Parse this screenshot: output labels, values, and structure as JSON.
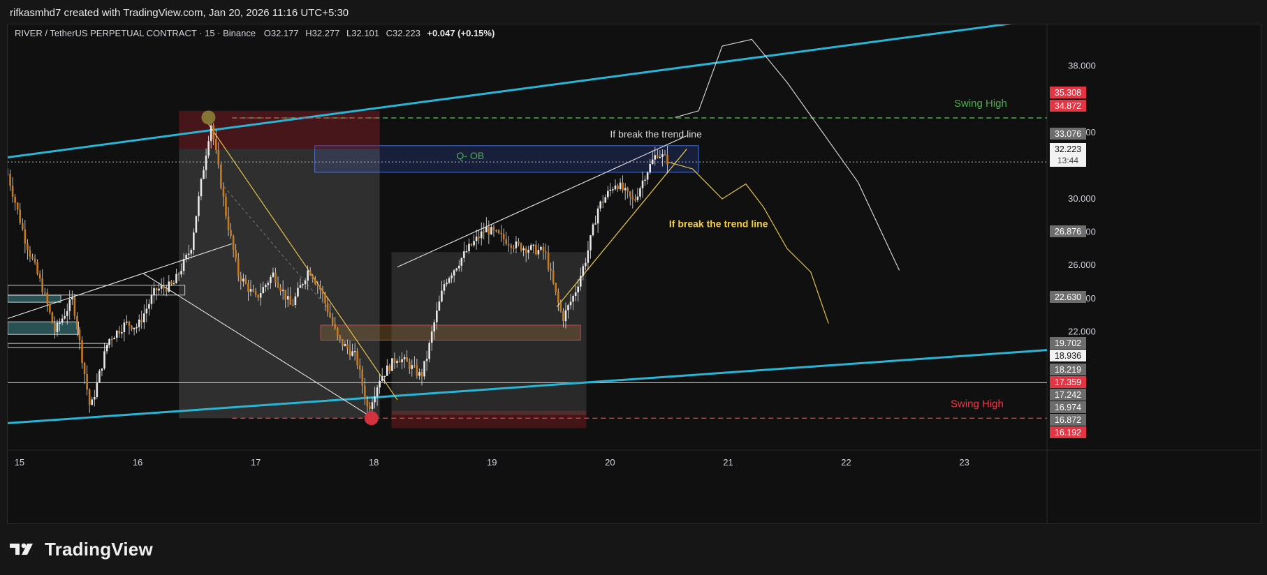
{
  "header": {
    "credit": "rifkasmhd7 created with TradingView.com, Jan 20, 2026 11:16 UTC+5:30"
  },
  "legend": {
    "symbol": "RIVER / TetherUS PERPETUAL CONTRACT · 15 · Binance",
    "o_label": "O",
    "o": "32.177",
    "h_label": "H",
    "h": "32.277",
    "l_label": "L",
    "l": "32.101",
    "c_label": "C",
    "c": "32.223",
    "change": "+0.047 (+0.15%)"
  },
  "footer": {
    "brand": "TradingView"
  },
  "colors": {
    "background": "#101010",
    "candle": "#c77a1f",
    "wick": "#e8e8e8",
    "channel": "#29b6d6",
    "bull_tag": "#6d6d6d",
    "bear_tag": "#e23645",
    "swing_high_top": "#4caf50",
    "swing_high_bottom": "#f23645",
    "trend": "#e5c34a"
  },
  "chart_data": {
    "type": "candlestick",
    "ylim": [
      15.3,
      40.5
    ],
    "xlim": [
      14.9,
      23.7
    ],
    "y_ticks": [
      38,
      34,
      30,
      28,
      26,
      24,
      22
    ],
    "y_tick_labels": [
      "38.000",
      "34.000",
      "30.000",
      "28.000",
      "26.000",
      "24.000",
      "22.000"
    ],
    "x_ticks": [
      15,
      16,
      17,
      18,
      19,
      20,
      21,
      22,
      23
    ],
    "x_tick_labels": [
      "15",
      "16",
      "17",
      "18",
      "19",
      "20",
      "21",
      "22",
      "23"
    ],
    "price_path": [
      [
        14.9,
        31.5
      ],
      [
        15.05,
        27.5
      ],
      [
        15.2,
        24.5
      ],
      [
        15.3,
        22.0
      ],
      [
        15.45,
        24.0
      ],
      [
        15.6,
        17.3
      ],
      [
        15.75,
        21.5
      ],
      [
        15.9,
        22.5
      ],
      [
        16.0,
        22.3
      ],
      [
        16.15,
        24.5
      ],
      [
        16.3,
        24.8
      ],
      [
        16.45,
        27.0
      ],
      [
        16.55,
        31.5
      ],
      [
        16.62,
        34.6
      ],
      [
        16.75,
        29.0
      ],
      [
        16.85,
        25.5
      ],
      [
        17.0,
        24.0
      ],
      [
        17.15,
        25.5
      ],
      [
        17.3,
        23.5
      ],
      [
        17.45,
        25.8
      ],
      [
        17.55,
        24.5
      ],
      [
        17.7,
        21.5
      ],
      [
        17.85,
        20.5
      ],
      [
        17.95,
        17.3
      ],
      [
        18.05,
        19.2
      ],
      [
        18.2,
        20.5
      ],
      [
        18.3,
        20.0
      ],
      [
        18.4,
        19.3
      ],
      [
        18.45,
        20.5
      ],
      [
        18.5,
        22.2
      ],
      [
        18.6,
        25.0
      ],
      [
        18.8,
        27.0
      ],
      [
        18.95,
        28.2
      ],
      [
        19.2,
        27.2
      ],
      [
        19.45,
        26.8
      ],
      [
        19.55,
        24.0
      ],
      [
        19.6,
        22.8
      ],
      [
        19.7,
        24.3
      ],
      [
        19.8,
        26.5
      ],
      [
        19.9,
        29.5
      ],
      [
        20.05,
        31.0
      ],
      [
        20.2,
        29.8
      ],
      [
        20.3,
        31.5
      ],
      [
        20.4,
        32.8
      ],
      [
        20.5,
        32.22
      ]
    ],
    "channel_lines": [
      {
        "from": [
          14.9,
          32.5
        ],
        "to": [
          23.55,
          40.7
        ]
      },
      {
        "from": [
          14.9,
          16.5
        ],
        "to": [
          23.7,
          20.9
        ]
      }
    ],
    "zones": [
      {
        "label": "Q- OB",
        "x": [
          17.5,
          20.75
        ],
        "y": [
          31.6,
          33.2
        ],
        "kind": "order-block"
      },
      {
        "label": "",
        "x": [
          16.35,
          18.05
        ],
        "y": [
          33.0,
          35.3
        ],
        "kind": "supply"
      },
      {
        "label": "",
        "x": [
          18.15,
          19.8
        ],
        "y": [
          16.2,
          17.25
        ],
        "kind": "demand"
      },
      {
        "label": "",
        "x": [
          17.55,
          19.75
        ],
        "y": [
          21.5,
          22.4
        ],
        "kind": "red-box"
      }
    ],
    "horizontal_levels": [
      {
        "label": "Swing High",
        "value": 34.872,
        "style": "dashed",
        "color": "#4caf50"
      },
      {
        "label": "Swing High",
        "value": 16.8,
        "style": "dashed",
        "color": "#f23645"
      },
      {
        "label": "",
        "value": 18.936,
        "style": "solid",
        "color": "#d0d0d0"
      }
    ],
    "annotations": [
      {
        "text": "If break the trend line",
        "at": [
          20.0,
          33.7
        ],
        "color": "#d8d8d8"
      },
      {
        "text": "If break the trend line",
        "at": [
          20.5,
          28.3
        ],
        "color": "#f3cf3f"
      },
      {
        "text": "Q- OB",
        "at": [
          18.7,
          32.4
        ],
        "color": "#4caf50"
      }
    ],
    "price_tags": [
      {
        "value": "35.308",
        "kind": "bear"
      },
      {
        "value": "34.872",
        "kind": "bear"
      },
      {
        "value": "33.076",
        "kind": "grey"
      },
      {
        "value": "32.223",
        "kind": "current",
        "countdown": "13:44"
      },
      {
        "value": "26.876",
        "kind": "grey"
      },
      {
        "value": "22.630",
        "kind": "grey"
      },
      {
        "value": "19.702",
        "kind": "grey"
      },
      {
        "value": "18.936",
        "kind": "white"
      },
      {
        "value": "18.219",
        "kind": "grey"
      },
      {
        "value": "17.359",
        "kind": "bear"
      },
      {
        "value": "17.242",
        "kind": "grey"
      },
      {
        "value": "16.974",
        "kind": "grey"
      },
      {
        "value": "16.872",
        "kind": "grey"
      },
      {
        "value": "16.192",
        "kind": "bear"
      }
    ]
  }
}
